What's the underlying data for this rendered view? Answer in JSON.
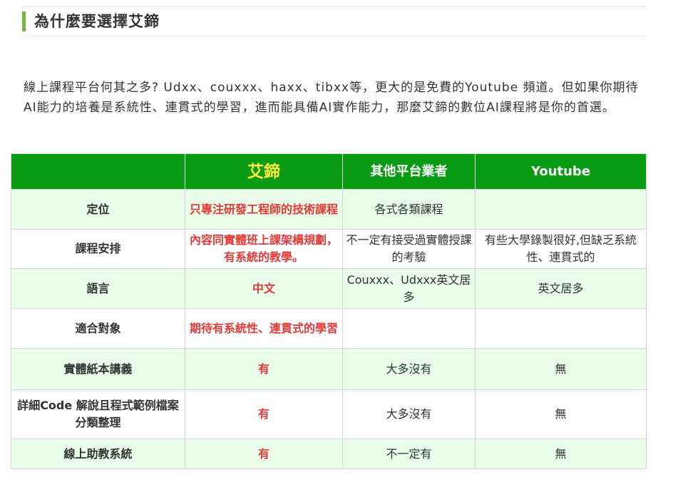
{
  "heading": {
    "title": "為什麼要選擇艾鍗"
  },
  "intro": {
    "text": "線上課程平台何其之多? Udxx、couxxx、haxx、tibxx等，更大的是免費的Youtube 頻道。但如果你期待AI能力的培養是系統性、連貫式的學習，進而能具備AI實作能力，那麼艾鍗的數位AI課程將是你的首選。"
  },
  "colors": {
    "accent_bar": "#7cb342",
    "header_bg": "#0b9c16",
    "brand_header_text": "#ffeb3b",
    "highlight_text": "#e53935",
    "row_alt_bg": "#e9fbe9"
  },
  "table": {
    "headers": [
      "",
      "艾鍗",
      "其他平台業者",
      "Youtube"
    ],
    "rows": [
      {
        "label": "定位",
        "ours": "只專注研發工程師的技術課程",
        "others": "各式各類課程",
        "youtube": ""
      },
      {
        "label": "課程安排",
        "ours": "內容同實體班上課架構規劃，有系統的教學。",
        "others": "不一定有接受過實體授課的考驗",
        "youtube": "有些大學錄製很好,但缺乏系統性、連貫式的"
      },
      {
        "label": "語言",
        "ours": "中文",
        "others": "Couxxx、Udxxx英文居多",
        "youtube": "英文居多"
      },
      {
        "label": "適合對象",
        "ours": "期待有系統性、連貫式的學習",
        "others": "",
        "youtube": ""
      },
      {
        "label": "實體紙本講義",
        "ours": "有",
        "others": "大多沒有",
        "youtube": "無"
      },
      {
        "label": "詳細Code 解說且程式範例檔案分類整理",
        "ours": "有",
        "others": "大多沒有",
        "youtube": "無"
      },
      {
        "label": "線上助教系統",
        "ours": "有",
        "others": "不一定有",
        "youtube": "無"
      }
    ]
  }
}
